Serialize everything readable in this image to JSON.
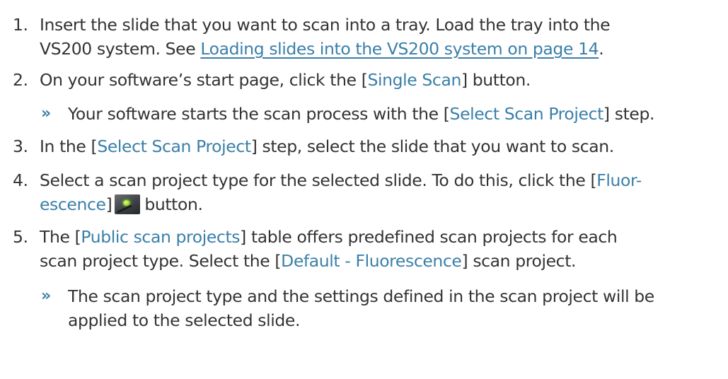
{
  "steps": [
    {
      "number": "1.",
      "line1": "Insert the slide that you want to scan into a tray. Load the tray into the",
      "line2_prefix": "VS200 system. See ",
      "line2_link": "Loading slides into the VS200 system on page 14",
      "line2_suffix": "."
    },
    {
      "number": "2.",
      "prefix": "On your software’s start page, click the [",
      "ui": "Single Scan",
      "suffix": "] button."
    },
    {
      "number": "3.",
      "prefix": "In the [",
      "ui": "Select Scan Project",
      "suffix": "] step, select the slide that you want to scan."
    },
    {
      "number": "4.",
      "line1_prefix": "Select a scan project type for the selected slide. To do this, click the [",
      "line1_ui": "Fluor-",
      "line2_ui": "escence",
      "line2_suffix_before_icon": "]",
      "icon": "fluorescence-icon",
      "line2_suffix": "button."
    },
    {
      "number": "5.",
      "line1_prefix": "The [",
      "line1_ui": "Public scan projects",
      "line1_suffix": "] table offers predefined scan projects for each",
      "line2_prefix": "scan project type. Select the [",
      "line2_ui": "Default - Fluorescence",
      "line2_suffix": "] scan project."
    }
  ],
  "results": [
    {
      "marker": "»",
      "prefix": "Your software starts the scan process with the [",
      "ui": "Select Scan Project",
      "suffix": "] step."
    },
    {
      "marker": "»",
      "line1": "The scan project type and the settings defined in the scan project will be",
      "line2": "applied to the selected slide."
    }
  ],
  "colors": {
    "text": "#333333",
    "accent": "#3a7fa8"
  }
}
